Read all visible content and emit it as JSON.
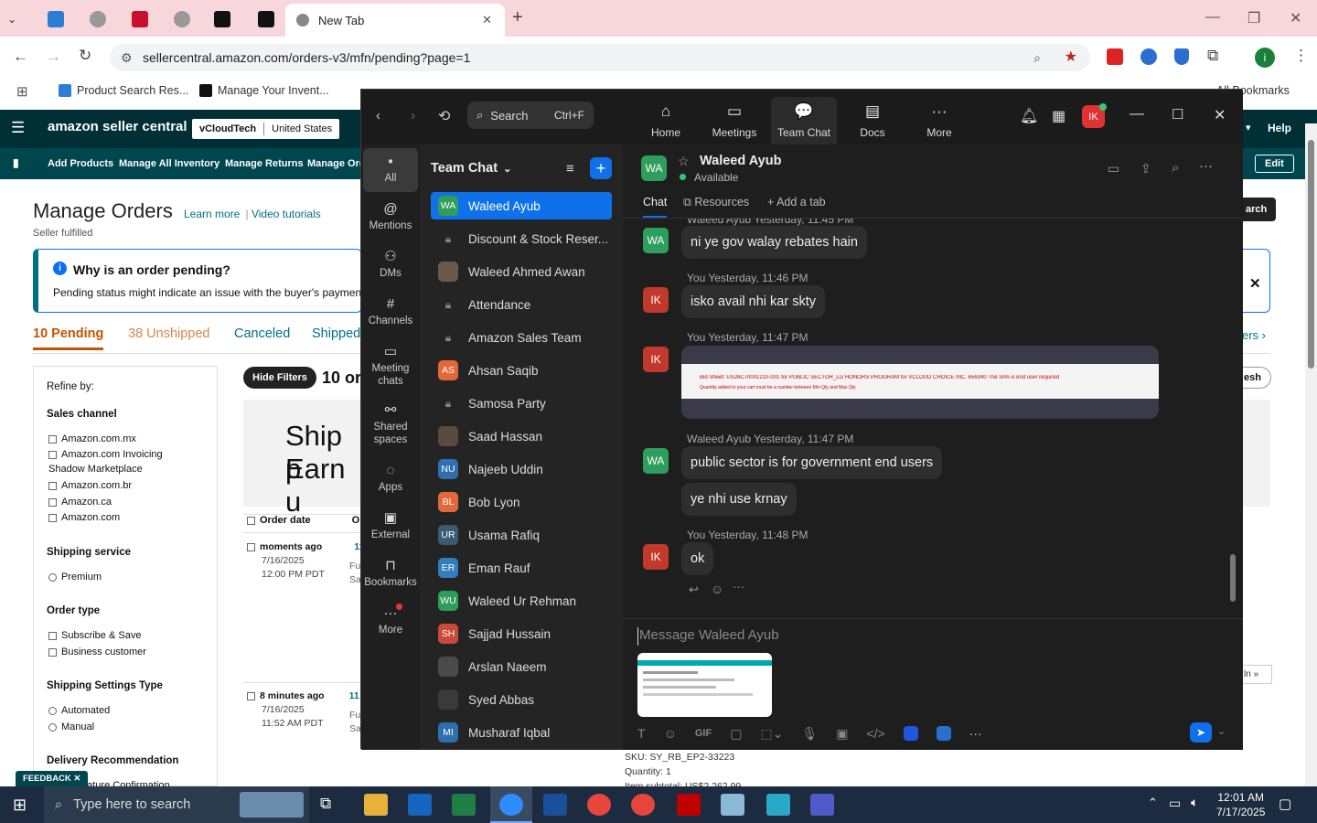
{
  "browser": {
    "tabs": [
      {
        "label": "New Tab"
      }
    ],
    "url": "sellercentral.amazon.com/orders-v3/mfn/pending?page=1",
    "bookmarks": [
      "Product Search Res...",
      "Manage Your Invent...",
      "All Bookmarks"
    ]
  },
  "amazon": {
    "brand": "amazon seller central",
    "store": "vCloudTech",
    "region": "United States",
    "help": "Help",
    "edit": "Edit",
    "nav": [
      "Add Products",
      "Manage All Inventory",
      "Manage Returns",
      "Manage Ord"
    ],
    "page_title": "Manage Orders",
    "learn_more": "Learn more",
    "video_tutorials": "Video tutorials",
    "subtitle": "Seller fulfilled",
    "info_title": "Why is an order pending?",
    "info_text": "Pending status might indicate an issue with the buyer's payment m",
    "tabs": [
      "10 Pending",
      "38 Unshipped",
      "Canceled",
      "Shipped"
    ],
    "tab_right": "ers ›",
    "hide_filters": "Hide Filters",
    "results": "10 or",
    "banner_text": [
      "Ship p",
      "Earn u"
    ],
    "search_btn": "arch",
    "refresh_btn": "esh",
    "refine_by": "Refine by:",
    "filters": {
      "sales_channel": {
        "label": "Sales channel",
        "options": [
          "Amazon.com.mx",
          "Amazon.com Invoicing",
          "Shadow Marketplace",
          "Amazon.com.br",
          "Amazon.ca",
          "Amazon.com"
        ]
      },
      "shipping_service": {
        "label": "Shipping service",
        "options": [
          "Premium"
        ]
      },
      "order_type": {
        "label": "Order type",
        "options": [
          "Subscribe & Save",
          "Business customer"
        ]
      },
      "shipping_settings": {
        "label": "Shipping Settings Type",
        "options": [
          "Automated",
          "Manual"
        ]
      },
      "delivery": {
        "label": "Delivery Recommendation",
        "options": [
          "nature Confirmation"
        ]
      }
    },
    "orders_header": [
      "Order date",
      "Or"
    ],
    "orders": [
      {
        "age": "moments ago",
        "date": "7/16/2025",
        "time": "12:00 PM PDT",
        "num": "11",
        "a": "Fu",
        "b": "Sa"
      },
      {
        "age": "8 minutes ago",
        "date": "7/16/2025",
        "time": "11:52 AM PDT",
        "num": "11",
        "a": "Fu",
        "b": "Sa"
      }
    ],
    "sku": "SKU: SY_RB_EP2-33223",
    "quantity": "Quantity: 1",
    "subtotal": "Item subtotal: US$2,262.99",
    "feedback": "FEEDBACK ✕",
    "right_tag": "ln »"
  },
  "zoom": {
    "search": "Search",
    "shortcut": "Ctrl+F",
    "top_items": [
      {
        "label": "Home",
        "icon": "⌂"
      },
      {
        "label": "Meetings",
        "icon": "▭"
      },
      {
        "label": "Team Chat",
        "icon": "💬"
      },
      {
        "label": "Docs",
        "icon": "▤"
      },
      {
        "label": "More",
        "icon": "···"
      }
    ],
    "user_initials": "IK",
    "rail": [
      {
        "label": "All",
        "icon": "▪"
      },
      {
        "label": "Mentions",
        "icon": "@"
      },
      {
        "label": "DMs",
        "icon": "⚇"
      },
      {
        "label": "Channels",
        "icon": "#"
      },
      {
        "label": "Meeting chats",
        "icon": "▭"
      },
      {
        "label": "Shared spaces",
        "icon": "⚯"
      },
      {
        "label": "Apps",
        "icon": "◌"
      },
      {
        "label": "External",
        "icon": "▣"
      },
      {
        "label": "Bookmarks",
        "icon": "⊓"
      },
      {
        "label": "More",
        "icon": "···"
      }
    ],
    "list_title": "Team Chat",
    "contacts": [
      {
        "name": "Waleed Ayub",
        "initials": "WA",
        "color": "#2e9e5b",
        "type": "avatar"
      },
      {
        "name": "Discount & Stock Reser...",
        "type": "lock"
      },
      {
        "name": "Waleed Ahmed Awan",
        "initials": "",
        "color": "#6b5a4a",
        "type": "avatar"
      },
      {
        "name": "Attendance",
        "type": "lock"
      },
      {
        "name": "Amazon Sales Team",
        "type": "lock"
      },
      {
        "name": "Ahsan Saqib",
        "initials": "AS",
        "color": "#e2673a",
        "type": "avatar"
      },
      {
        "name": "Samosa Party",
        "type": "lock"
      },
      {
        "name": "Saad Hassan",
        "initials": "",
        "color": "#5a4a3f",
        "type": "avatar"
      },
      {
        "name": "Najeeb Uddin",
        "initials": "NU",
        "color": "#2f6fb0",
        "type": "avatar"
      },
      {
        "name": "Bob Lyon",
        "initials": "BL",
        "color": "#e2673a",
        "type": "avatar"
      },
      {
        "name": "Usama Rafiq",
        "initials": "UR",
        "color": "#3d5a73",
        "type": "avatar"
      },
      {
        "name": "Eman Rauf",
        "initials": "ER",
        "color": "#2f7fbf",
        "type": "avatar"
      },
      {
        "name": "Waleed Ur Rehman",
        "initials": "WU",
        "color": "#2e9e5b",
        "type": "avatar"
      },
      {
        "name": "Sajjad Hussain",
        "initials": "SH",
        "color": "#c94a3a",
        "type": "avatar"
      },
      {
        "name": "Arslan Naeem",
        "initials": "",
        "color": "#4a4a4a",
        "type": "avatar"
      },
      {
        "name": "Syed Abbas",
        "initials": "",
        "color": "#3a3a3a",
        "type": "avatar"
      },
      {
        "name": "Musharaf Iqbal",
        "initials": "MI",
        "color": "#2f6fb0",
        "type": "avatar"
      }
    ],
    "chat": {
      "name": "Waleed Ayub",
      "initials": "WA",
      "status": "Available",
      "tabs": [
        "Chat",
        "Resources",
        "Add a tab"
      ],
      "messages": [
        {
          "meta": "Waleed Ayub Yesterday, 11:45 PM",
          "text": "ni ye gov walay rebates hain",
          "who": "WA"
        },
        {
          "meta": "You Yesterday, 11:46 PM",
          "text": "isko avail nhi kar skty",
          "who": "IK"
        },
        {
          "meta": "You Yesterday, 11:47 PM",
          "text": "",
          "who": "IK"
        },
        {
          "meta": "Waleed Ayub Yesterday, 11:47 PM",
          "text": "public sector is for government end users",
          "who": "WA"
        },
        {
          "meta": "",
          "text": "ye nhi use krnay",
          "who": ""
        },
        {
          "meta": "You Yesterday, 11:48 PM",
          "text": "ok",
          "who": "IK"
        }
      ],
      "image_text": "Bid Sheet:  US26C70001210-001 for PUBLIC SECTOR_LG HONORS PROGRAM for VCLOUD CHOICE INC. 656340  The SPA is end user required",
      "image_text2": "Quantity added to your cart must be a number between Min Qty and Max Qty",
      "input_placeholder": "Message Waleed Ayub",
      "toolbar_gif": "GIF"
    }
  },
  "taskbar": {
    "search": "Type here to search",
    "time": "12:01 AM",
    "date": "7/17/2025"
  }
}
